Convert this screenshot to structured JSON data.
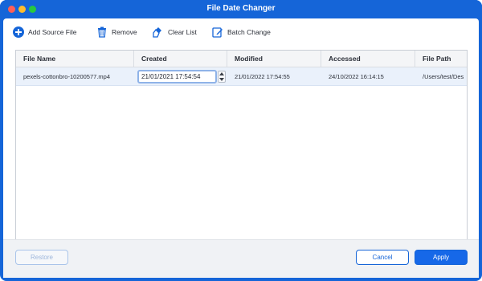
{
  "window": {
    "title": "File Date Changer"
  },
  "toolbar": {
    "add_label": "Add Source File",
    "remove_label": "Remove",
    "clear_label": "Clear List",
    "batch_label": "Batch Change"
  },
  "table": {
    "columns": [
      "File Name",
      "Created",
      "Modified",
      "Accessed",
      "File Path"
    ],
    "rows": [
      {
        "file_name": "pexels-cottonbro-10200577.mp4",
        "created": "21/01/2021 17:54:54",
        "modified": "21/01/2022 17:54:55",
        "accessed": "24/10/2022 16:14:15",
        "file_path": "/Users/test/Des"
      }
    ]
  },
  "footer": {
    "restore_label": "Restore",
    "cancel_label": "Cancel",
    "apply_label": "Apply"
  },
  "colors": {
    "accent": "#1565d8",
    "row_selected": "#eaf1fb",
    "close": "#ff5f57",
    "minimize": "#febc2e",
    "maximize": "#28c840"
  },
  "icons": [
    "plus-circle-icon",
    "trash-icon",
    "clear-list-icon",
    "batch-edit-icon",
    "chevron-up-icon",
    "chevron-down-icon"
  ]
}
